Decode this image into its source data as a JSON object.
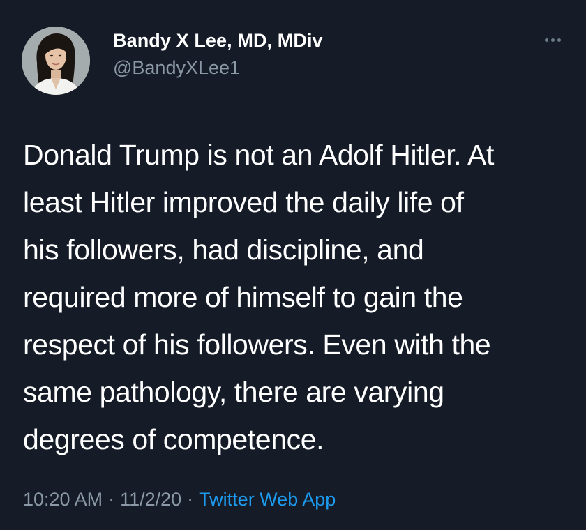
{
  "author": {
    "display_name": "Bandy X Lee, MD, MDiv",
    "handle": "@BandyXLee1"
  },
  "tweet": {
    "text": "Donald Trump is not an Adolf Hitler.  At\nleast Hitler improved the daily life of\nhis followers, had discipline, and\nrequired more of himself to gain the\nrespect of his followers.  Even with the\nsame pathology, there are varying\ndegrees of competence.",
    "time": "10:20 AM",
    "date": "11/2/20",
    "separator": "·",
    "source": "Twitter Web App"
  },
  "icons": {
    "more": "more-horizontal-icon"
  },
  "colors": {
    "background": "#151c28",
    "secondary_text": "#8b98a5",
    "link": "#1d9bf0"
  }
}
